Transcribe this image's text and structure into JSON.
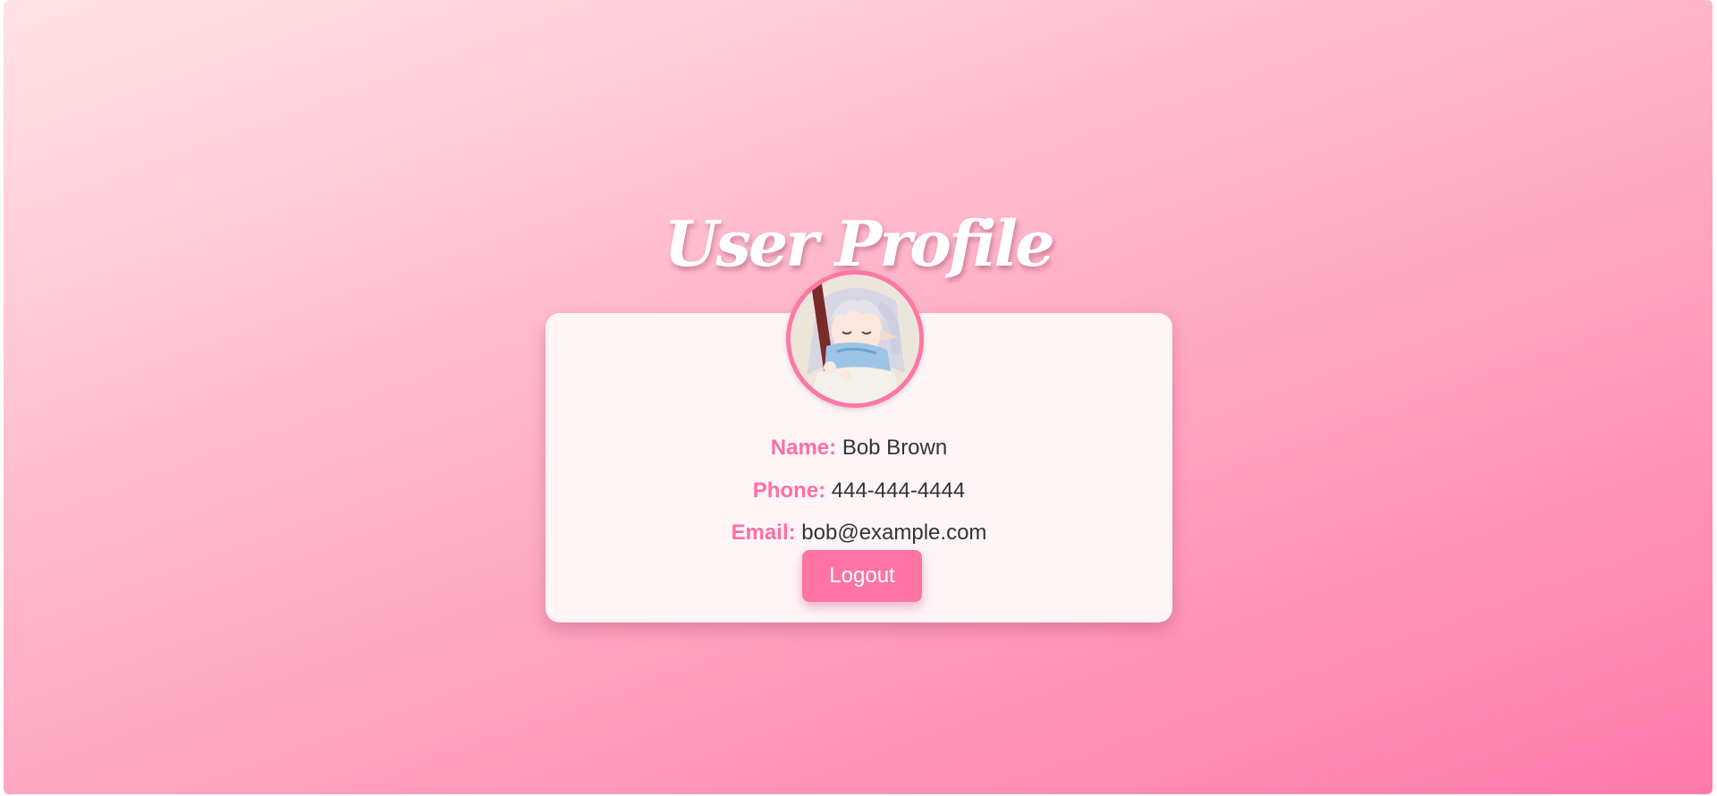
{
  "profile": {
    "title": "User Profile",
    "avatar_icon": "anime-character-avatar-icon",
    "name_label": "Name:",
    "name_value": "Bob Brown",
    "phone_label": "Phone:",
    "phone_value": "444-444-4444",
    "email_label": "Email:",
    "email_value": "bob@example.com",
    "logout_label": "Logout"
  },
  "colors": {
    "accent": "#ff74a4",
    "label": "#ff6f9f",
    "card_background": "#fff5f7",
    "gradient_start": "#ffe2e6",
    "gradient_end": "#ff7aa9"
  }
}
